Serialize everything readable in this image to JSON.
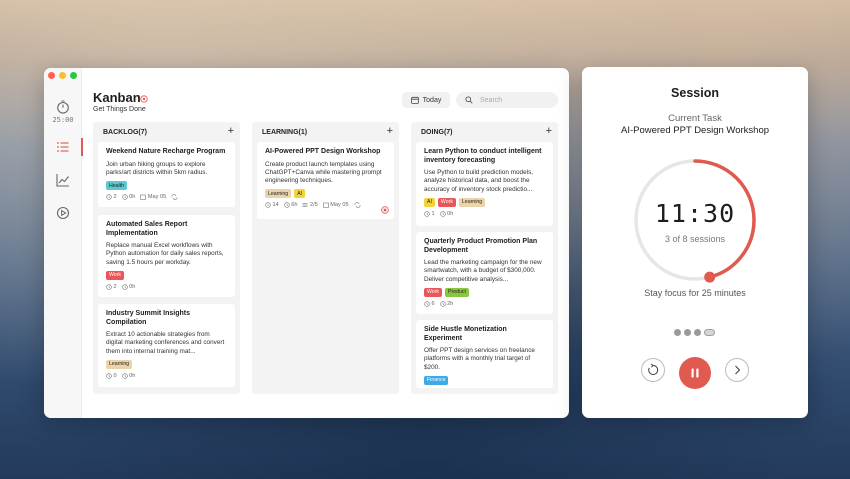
{
  "app": {
    "title": "Kanban",
    "subtitle": "Get Things Done"
  },
  "sidebar": {
    "timer": "25:00"
  },
  "toolbar": {
    "today_label": "Today",
    "search_placeholder": "Search"
  },
  "colors": {
    "accent": "#e05a4f",
    "work": "#e8575a",
    "health": "#5bc9cf",
    "learning": "#ecd4aa",
    "ai": "#f1d43c",
    "product": "#8cc541",
    "finance": "#3fa9e7"
  },
  "columns": [
    {
      "title": "BACKLOG(7)",
      "cards": [
        {
          "title": "Weekend Nature Recharge Program",
          "desc": "Join urban hiking groups to explore parks/art districts within 5km radius.",
          "tags": [
            "Health"
          ],
          "meta": {
            "pomodoros": "2",
            "time": "0h",
            "date": "May 05"
          }
        },
        {
          "title": "Automated Sales Report Implementation",
          "desc": "Replace manual Excel workflows with Python automation for daily sales reports, saving 1.5 hours per workday.",
          "tags": [
            "Work"
          ],
          "meta": {
            "pomodoros": "2",
            "time": "0h"
          }
        },
        {
          "title": "Industry Summit Insights Compilation",
          "desc": "Extract 10 actionable strategies from digital marketing conferences and convert them into internal training mat...",
          "tags": [
            "Learning"
          ],
          "meta": {
            "pomodoros": "0",
            "time": "0h"
          }
        }
      ]
    },
    {
      "title": "LEARNING(1)",
      "cards": [
        {
          "title": "AI-Powered PPT Design Workshop",
          "desc": "Create product launch templates using ChatGPT+Canva while mastering prompt engineering techniques.",
          "tags": [
            "Learning",
            "AI"
          ],
          "meta": {
            "pomodoros": "14",
            "time": "6h",
            "subtasks": "2/5",
            "date": "May 05"
          }
        }
      ]
    },
    {
      "title": "DOING(7)",
      "cards": [
        {
          "title": "Learn Python to conduct intelligent inventory forecasting",
          "desc": "Use Python to build prediction models, analyze historical data, and boost the accuracy of inventory stock predictio...",
          "tags": [
            "AI",
            "Work",
            "Learning"
          ],
          "meta": {
            "pomodoros": "1",
            "time": "0h"
          }
        },
        {
          "title": "Quarterly Product Promotion Plan Development",
          "desc": "Lead the marketing campaign for the new smartwatch, with a budget of $300,000. Deliver competitive analysis...",
          "tags": [
            "Work",
            "Product"
          ],
          "meta": {
            "pomodoros": "6",
            "time": "2h"
          }
        },
        {
          "title": "Side Hustle Monetization Experiment",
          "desc": "Offer PPT design services on freelance platforms with a monthly trial target of $200.",
          "tags": [
            "Finance"
          ]
        }
      ]
    }
  ],
  "session": {
    "title": "Session",
    "current_label": "Current Task",
    "task": "AI-Powered PPT Design Workshop",
    "time": "11:30",
    "sessions": "3 of 8 sessions",
    "focus": "Stay focus for 25 minutes",
    "progress": 0.46,
    "completed_sessions": 3,
    "session_dots": 4
  }
}
